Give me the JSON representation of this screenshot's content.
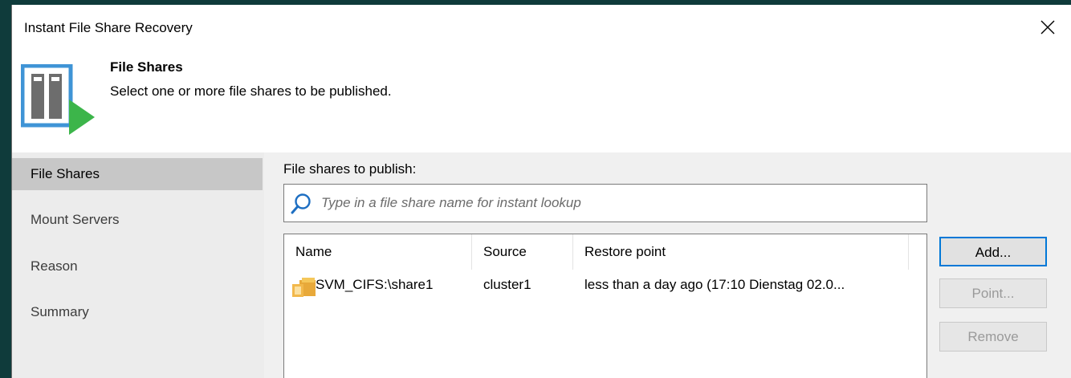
{
  "window": {
    "title": "Instant File Share Recovery",
    "close_icon": "close-icon"
  },
  "header": {
    "title": "File Shares",
    "subtitle": "Select one or more file shares to be published.",
    "icon": "file-share-publish-icon",
    "colors": {
      "frame": "#3f94d6",
      "body": "#6d6d6d",
      "arrow": "#3cb54a"
    }
  },
  "sidebar": {
    "items": [
      {
        "label": "File Shares",
        "active": true
      },
      {
        "label": "Mount Servers",
        "active": false
      },
      {
        "label": "Reason",
        "active": false
      },
      {
        "label": "Summary",
        "active": false
      }
    ]
  },
  "main": {
    "label": "File shares to publish:",
    "search": {
      "placeholder": "Type in a file share name for instant lookup",
      "value": "",
      "icon": "search-icon"
    },
    "table": {
      "columns": [
        "Name",
        "Source",
        "Restore point"
      ],
      "rows": [
        {
          "name": "SVM_CIFS:\\share1",
          "source": "cluster1",
          "restore_point": "less than a day ago (17:10 Dienstag 02.0...",
          "icon": "file-share-folder-icon"
        }
      ]
    },
    "buttons": {
      "add": "Add...",
      "point": "Point...",
      "remove": "Remove"
    }
  }
}
